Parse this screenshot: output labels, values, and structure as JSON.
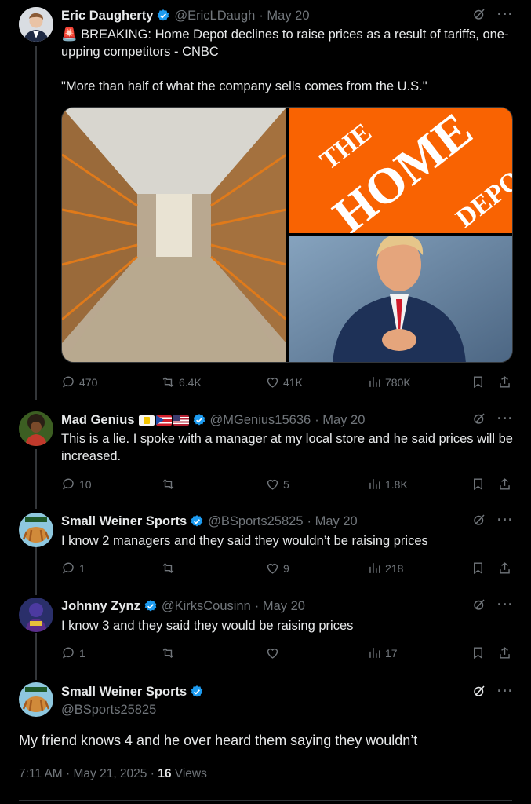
{
  "tweets": [
    {
      "name": "Eric Daugherty",
      "handle": "@EricLDaugh",
      "date": "· May 20",
      "text": "🚨 BREAKING: Home Depot declines to raise prices as a result of tariffs, one-upping competitors - CNBC\n\n\"More than half of what the company sells comes from the U.S.\"",
      "media": {
        "logo_text": "THE HOME DEPOT",
        "colors": {
          "orange": "#f96302"
        }
      },
      "replies": "470",
      "reposts": "6.4K",
      "likes": "41K",
      "views": "780K"
    },
    {
      "name": "Mad Genius",
      "handle": "@MGenius15636",
      "date": "· May 20",
      "text": "This is a lie. I spoke with a manager at my local store and he said prices will be increased.",
      "replies": "10",
      "reposts": "",
      "likes": "5",
      "views": "1.8K"
    },
    {
      "name": "Small Weiner Sports",
      "handle": "@BSports25825",
      "date": "· May 20",
      "text": "I know 2 managers and they said they wouldn’t be raising prices",
      "replies": "1",
      "reposts": "",
      "likes": "9",
      "views": "218"
    },
    {
      "name": "Johnny Zynz",
      "handle": "@KirksCousinn",
      "date": "· May 20",
      "text": "I know 3 and they said they would be raising prices",
      "replies": "1",
      "reposts": "",
      "likes": "",
      "views": "17"
    }
  ],
  "main": {
    "name": "Small Weiner Sports",
    "handle": "@BSports25825",
    "text": "My friend knows 4 and he over heard them saying they wouldn’t",
    "timestamp": "7:11 AM · May 21, 2025 · ",
    "views_count": "16",
    "views_label": " Views"
  },
  "colors": {
    "verified": "#1d9bf0",
    "muted": "#71767b",
    "text": "#e7e9ea",
    "background": "#000000"
  }
}
